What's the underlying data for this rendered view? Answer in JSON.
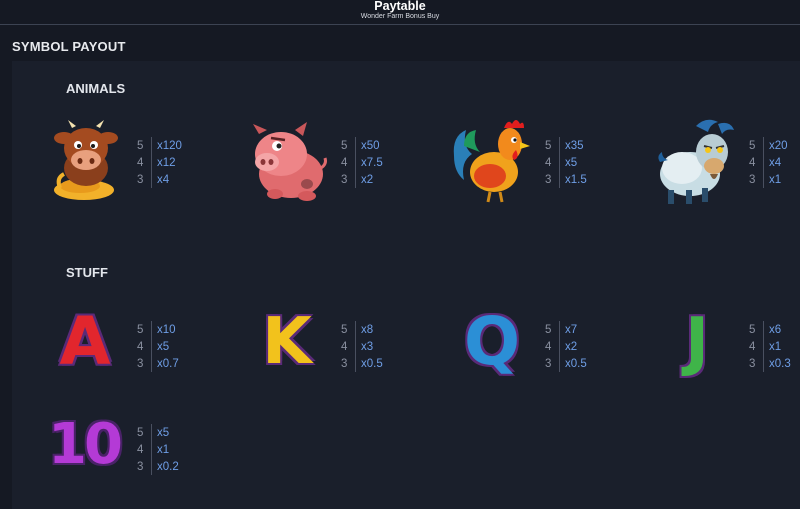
{
  "header": {
    "title": "Paytable",
    "subtitle": "Wonder Farm Bonus Buy"
  },
  "section_title": "SYMBOL PAYOUT",
  "groups": {
    "animals_label": "ANIMALS",
    "stuff_label": "STUFF"
  },
  "symbols": {
    "cow": {
      "icon": "cow-icon",
      "counts": [
        "5",
        "4",
        "3"
      ],
      "payouts": [
        "x120",
        "x12",
        "x4"
      ]
    },
    "pig": {
      "icon": "pig-icon",
      "counts": [
        "5",
        "4",
        "3"
      ],
      "payouts": [
        "x50",
        "x7.5",
        "x2"
      ]
    },
    "rooster": {
      "icon": "rooster-icon",
      "counts": [
        "5",
        "4",
        "3"
      ],
      "payouts": [
        "x35",
        "x5",
        "x1.5"
      ]
    },
    "goat": {
      "icon": "goat-icon",
      "counts": [
        "5",
        "4",
        "3"
      ],
      "payouts": [
        "x20",
        "x4",
        "x1"
      ]
    },
    "a": {
      "glyph": "A",
      "color": "#e2262d",
      "counts": [
        "5",
        "4",
        "3"
      ],
      "payouts": [
        "x10",
        "x5",
        "x0.7"
      ]
    },
    "k": {
      "glyph": "K",
      "color": "#f2c21c",
      "counts": [
        "5",
        "4",
        "3"
      ],
      "payouts": [
        "x8",
        "x3",
        "x0.5"
      ]
    },
    "q": {
      "glyph": "Q",
      "color": "#2b8fd6",
      "counts": [
        "5",
        "4",
        "3"
      ],
      "payouts": [
        "x7",
        "x2",
        "x0.5"
      ]
    },
    "j": {
      "glyph": "J",
      "color": "#3fb449",
      "counts": [
        "5",
        "4",
        "3"
      ],
      "payouts": [
        "x6",
        "x1",
        "x0.3"
      ]
    },
    "ten": {
      "glyph": "10",
      "color": "#b43ad6",
      "counts": [
        "5",
        "4",
        "3"
      ],
      "payouts": [
        "x5",
        "x1",
        "x0.2"
      ]
    }
  }
}
